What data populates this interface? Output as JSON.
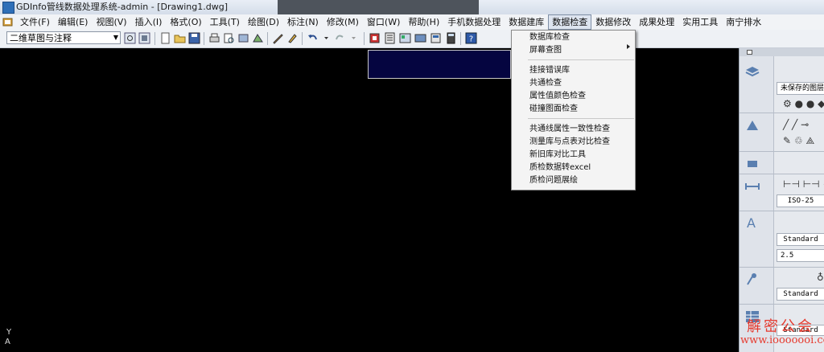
{
  "window": {
    "title": "GDInfo管线数据处理系统-admin - [Drawing1.dwg]"
  },
  "menubar": {
    "items": [
      "文件(F)",
      "编辑(E)",
      "视图(V)",
      "插入(I)",
      "格式(O)",
      "工具(T)",
      "绘图(D)",
      "标注(N)",
      "修改(M)",
      "窗口(W)",
      "帮助(H)",
      "手机数据处理",
      "数据建库",
      "数据检查",
      "数据修改",
      "成果处理",
      "实用工具",
      "南宁排水"
    ],
    "active_item": "数据检查"
  },
  "toolbar": {
    "layer_select_value": "二维草图与注释"
  },
  "dropdown": {
    "items": [
      "数据库检查",
      "屏幕查图",
      "挂接错误库",
      "共通检查",
      "属性值颜色检查",
      "碰撞图面检查",
      "共通线属性一致性检查",
      "测量库与点表对比检查",
      "新旧库对比工具",
      "质检数据转excel",
      "质检问题展绘"
    ]
  },
  "canvas": {
    "ucs_y_label": "Y",
    "ucs_arrow": "A"
  },
  "palette": {
    "layer_state": "未保存的图层",
    "dim_style": "ISO-25",
    "text_style": "Standard",
    "text_height": "2.5",
    "mleader_style": "Standard",
    "table_style": "Standard"
  },
  "watermark": {
    "line1": "解密公会",
    "line2": "www.iooooooi.com"
  },
  "colors": {
    "menu_active_border": "#7f8fa6",
    "canvas_background": "#000000",
    "selection_rect_fill": "#050540",
    "watermark_red": "#e63a2e"
  }
}
